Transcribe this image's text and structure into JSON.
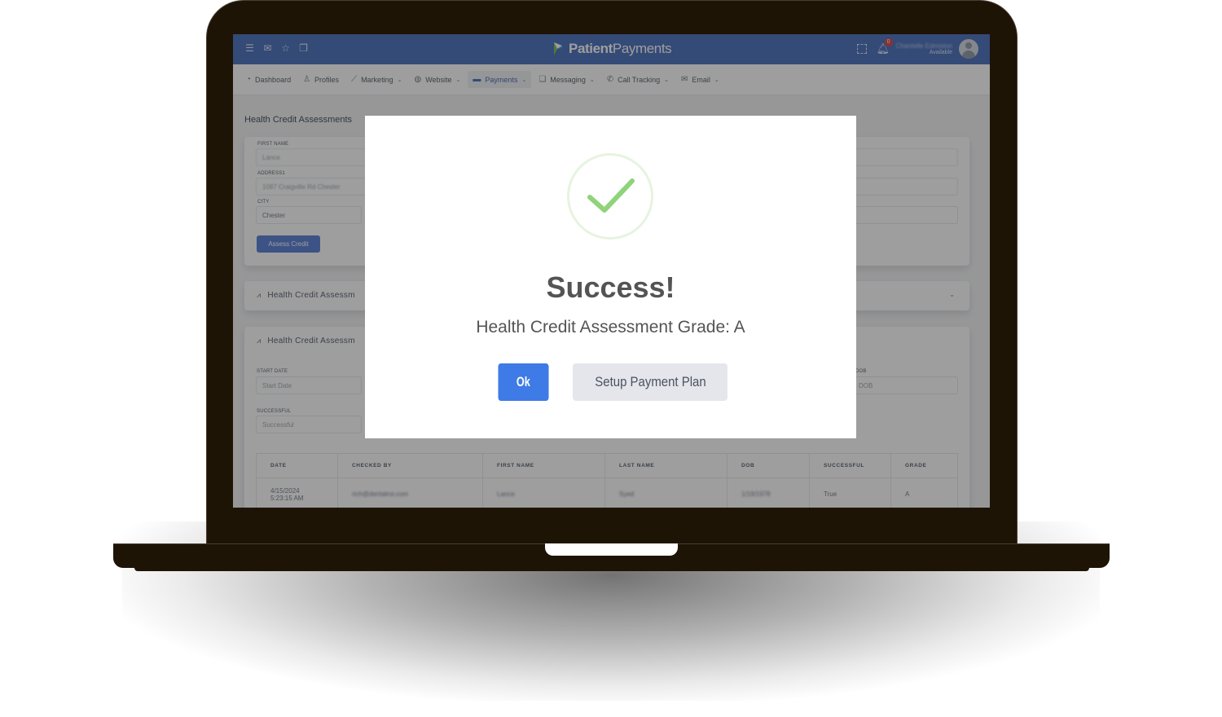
{
  "app": {
    "brand_bold": "Patient",
    "brand_light": "Payments"
  },
  "topbar": {
    "icons": [
      "menu-icon",
      "mail-icon",
      "star-icon",
      "chat-icon"
    ],
    "notification_count": "0",
    "user_name": "Chantelle Edmiston",
    "user_status": "Available"
  },
  "nav": {
    "items": [
      {
        "label": "Dashboard",
        "icon": "dashboard-icon",
        "dropdown": false
      },
      {
        "label": "Profiles",
        "icon": "profile-icon",
        "dropdown": false
      },
      {
        "label": "Marketing",
        "icon": "chart-line-icon",
        "dropdown": true
      },
      {
        "label": "Website",
        "icon": "globe-icon",
        "dropdown": true
      },
      {
        "label": "Payments",
        "icon": "credit-card-icon",
        "dropdown": true,
        "active": true
      },
      {
        "label": "Messaging",
        "icon": "messages-icon",
        "dropdown": true
      },
      {
        "label": "Call Tracking",
        "icon": "phone-icon",
        "dropdown": true
      },
      {
        "label": "Email",
        "icon": "envelope-icon",
        "dropdown": true
      }
    ]
  },
  "page": {
    "title": "Health Credit Assessments",
    "form": {
      "first_name_label": "FIRST NAME",
      "first_name_value": "Lance",
      "address_label": "ADDRESS1",
      "address_value": "1087 Craigville Rd Chester",
      "city_label": "CITY",
      "city_value": "Chester",
      "assess_button": "Assess Credit"
    },
    "section2_title": "Health Credit Assessm",
    "section3": {
      "title": "Health Credit Assessm",
      "start_date_label": "START DATE",
      "start_date_placeholder": "Start Date",
      "successful_label": "SUCCESSFUL",
      "successful_placeholder": "Successful",
      "dob_label": "DOB",
      "dob_placeholder": "DOB"
    },
    "table": {
      "columns": [
        "DATE",
        "CHECKED BY",
        "FIRST NAME",
        "LAST NAME",
        "DOB",
        "SUCCESSFUL",
        "GRADE"
      ],
      "rows": [
        {
          "date_line1": "4/15/2024",
          "date_line2": "5:23:15 AM",
          "checked_by": "rich@dentalroi.com",
          "first_name": "Lance",
          "last_name": "Syed",
          "dob": "1/19/1978",
          "successful": "True",
          "grade": "A"
        }
      ]
    }
  },
  "modal": {
    "icon": "success-check-icon",
    "title": "Success!",
    "message": "Health Credit Assessment Grade: A",
    "ok_label": "Ok",
    "plan_label": "Setup Payment Plan",
    "colors": {
      "ok_button": "#3f7be6",
      "plan_button": "#e4e6eb",
      "check": "#8fd37a"
    }
  }
}
